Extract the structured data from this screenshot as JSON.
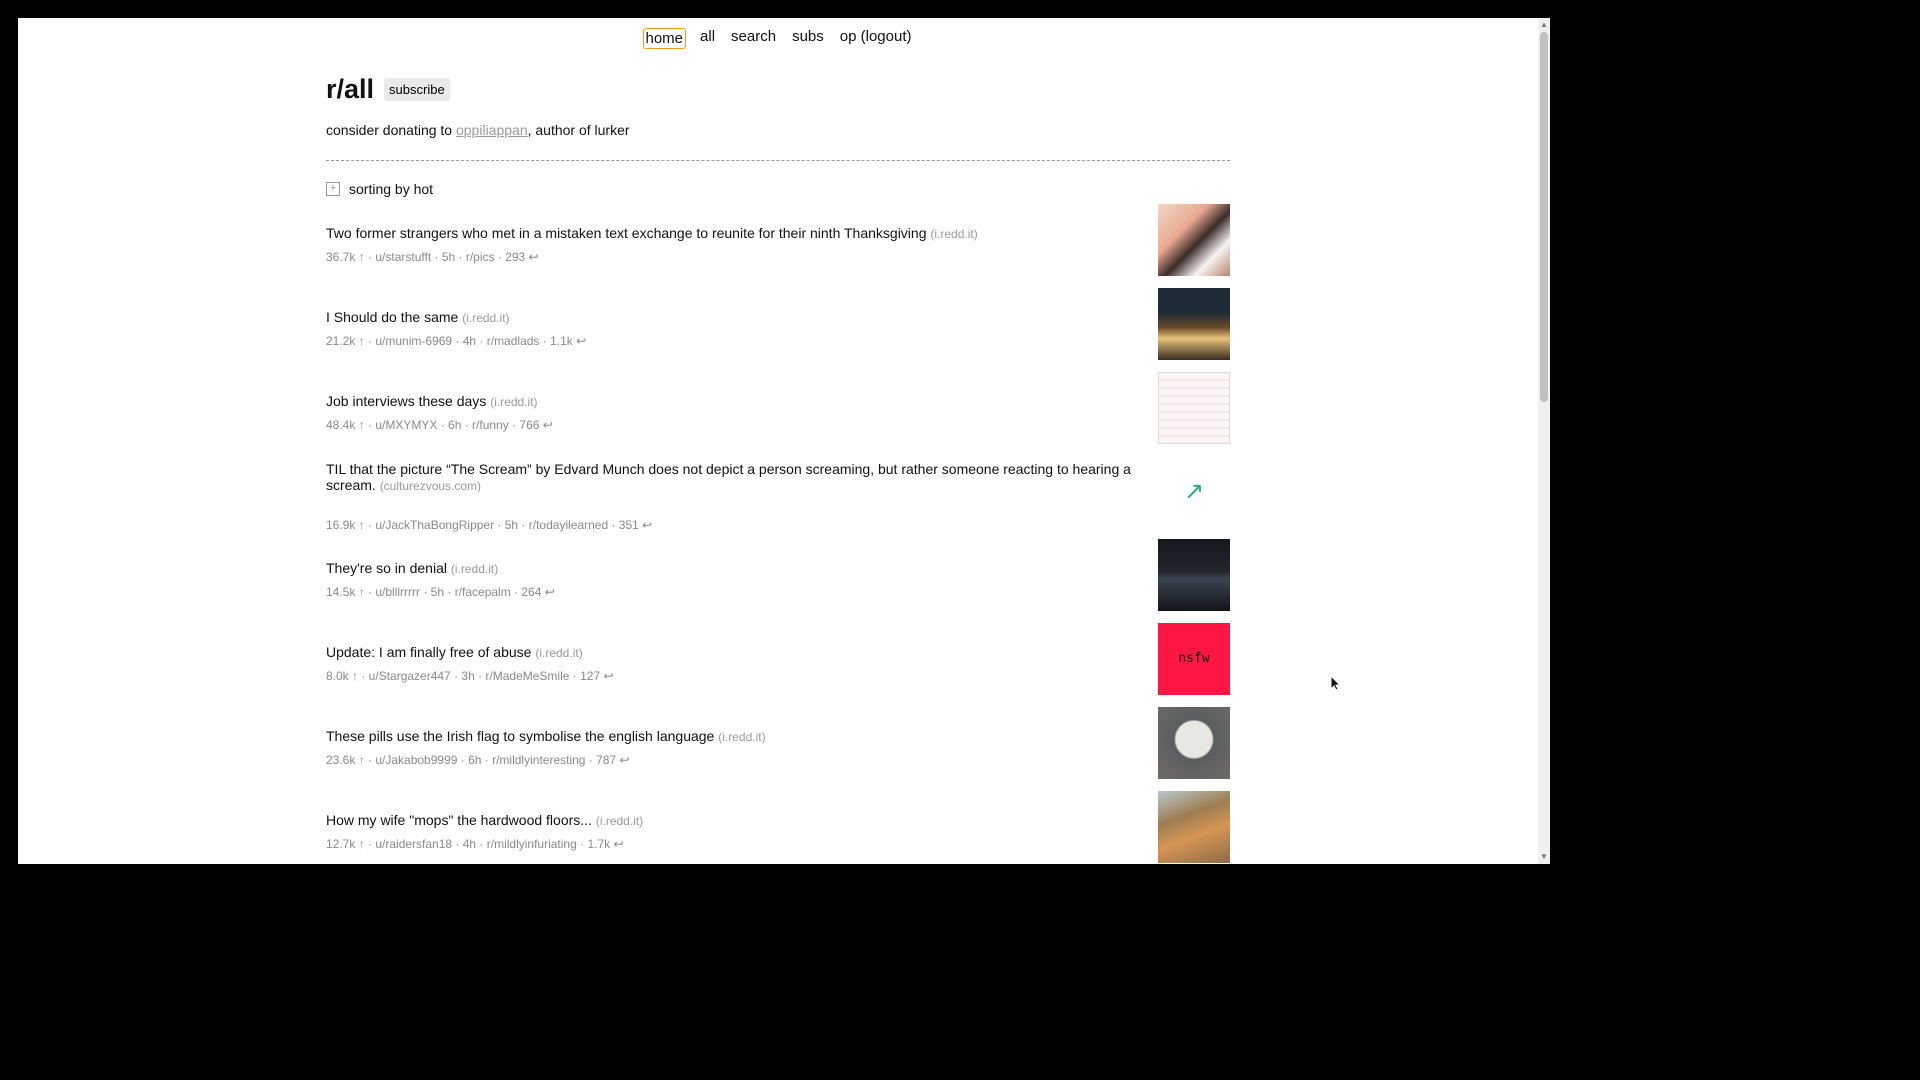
{
  "nav": {
    "home": "home",
    "all": "all",
    "search": "search",
    "subs": "subs",
    "user": "op (logout)"
  },
  "header": {
    "title": "r/all",
    "subscribe_label": "subscribe"
  },
  "donate": {
    "prefix": "consider donating to ",
    "link": "oppiliappan",
    "suffix": ", author of lurker"
  },
  "sort": {
    "icon": "plus-box-icon",
    "label": "sorting by hot"
  },
  "posts": [
    {
      "title": "Two former strangers who met in a mistaken text exchange to reunite for their ninth Thanksgiving",
      "domain": "(i.redd.it)",
      "meta": "36.7k ↑  ·  u/starstufft  ·  5h  · r/pics · 293 ↩"
    },
    {
      "title": "I Should do the same",
      "domain": "(i.redd.it)",
      "meta": "21.2k ↑  ·  u/munim-6969  ·  4h  · r/madlads · 1.1k ↩"
    },
    {
      "title": "Job interviews these days",
      "domain": "(i.redd.it)",
      "meta": "48.4k ↑  ·  u/MXYMYX  ·  6h  · r/funny · 766 ↩"
    },
    {
      "title": "TIL that the picture “The Scream” by Edvard Munch does not depict a person screaming, but rather someone reacting to hearing a scream.",
      "domain": "(culturezvous.com)",
      "meta": "16.9k ↑  ·  u/JackThaBongRipper  ·  5h  · r/todayilearned · 351 ↩"
    },
    {
      "title": "They're so in denial",
      "domain": "(i.redd.it)",
      "meta": "14.5k ↑  ·  u/blllrrrrr  ·  5h  · r/facepalm · 264 ↩"
    },
    {
      "title": "Update: I am finally free of abuse",
      "domain": "(i.redd.it)",
      "meta": "8.0k ↑  ·  u/Stargazer447  ·  3h  · r/MadeMeSmile · 127 ↩"
    },
    {
      "title": "These pills use the Irish flag to symbolise the english language",
      "domain": "(i.redd.it)",
      "meta": "23.6k ↑  ·  u/Jakabob9999  ·  6h  · r/mildlyinteresting · 787 ↩"
    },
    {
      "title": "How my wife \"mops\" the hardwood floors...",
      "domain": "(i.redd.it)",
      "meta": "12.7k ↑  ·  u/raidersfan18  ·  4h  · r/mildlyinfuriating · 1.7k ↩"
    }
  ],
  "thumbs": {
    "link_icon": "↗",
    "nsfw": "nsfw"
  },
  "colors": {
    "accent": "#e89a21",
    "nsfw": "#ff1744",
    "link_arrow": "#2aa58d"
  }
}
